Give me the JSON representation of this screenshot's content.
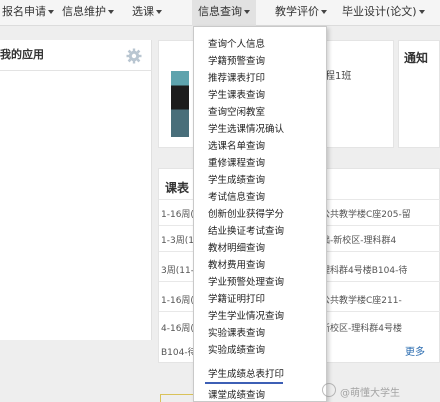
{
  "nav": {
    "items": [
      {
        "label": "报名申请"
      },
      {
        "label": "信息维护"
      },
      {
        "label": "选课"
      },
      {
        "label": "信息查询"
      },
      {
        "label": "教学评价"
      },
      {
        "label": "毕业设计(论文)"
      }
    ]
  },
  "apps_panel": {
    "title": "我的应用",
    "settings_icon": "gear-icon"
  },
  "profile_panel": {
    "class_text": "程1班"
  },
  "notice_panel": {
    "title": "通知"
  },
  "schedule_panel": {
    "title": "课表",
    "rows": [
      {
        "left": "1-16周(",
        "right": "公共教学楼C座205-留"
      },
      {
        "left": "1-3周(1",
        "right": "础-新校区-理科群4"
      },
      {
        "left": "3周(11-",
        "right": "理科群4号楼B104-待"
      },
      {
        "left": "1-16周(",
        "right": "公共教学楼C座211-"
      },
      {
        "left": "4-16周(",
        "right": "新校区-理科群4号楼"
      },
      {
        "left": "B104-待",
        "right": ""
      }
    ],
    "more_label": "更多"
  },
  "dropdown": {
    "items": [
      "查询个人信息",
      "学籍预警查询",
      "推荐课表打印",
      "学生课表查询",
      "查询空闲教室",
      "学生选课情况确认",
      "选课名单查询",
      "重修课程查询",
      "学生成绩查询",
      "考试信息查询",
      "创新创业获得学分",
      "结业换证考试查询",
      "教材明细查询",
      "教材费用查询",
      "学业预警处理查询",
      "学籍证明打印",
      "学生学业情况查询",
      "实验课表查询",
      "实验成绩查询",
      "学生成绩总表打印",
      "课堂成绩查询"
    ]
  },
  "watermark": {
    "text": "@萌懂大学生"
  },
  "colors": {
    "accent": "#3d5fb5",
    "link": "#2b6cb0"
  }
}
